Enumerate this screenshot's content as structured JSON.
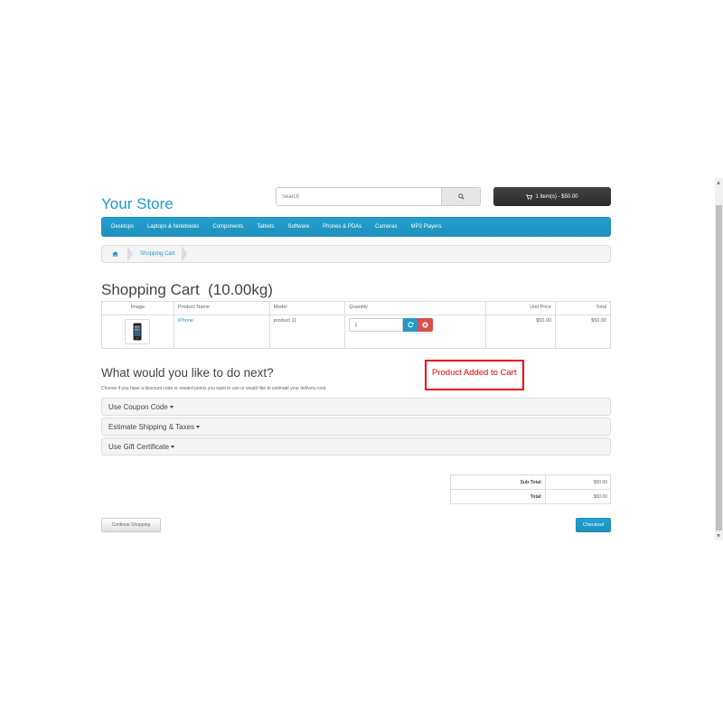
{
  "header": {
    "store_name": "Your Store",
    "search_placeholder": "Search",
    "cart_summary": "1 item(s) - $50.00"
  },
  "nav": {
    "items": [
      "Desktops",
      "Laptops & Notebooks",
      "Components",
      "Tablets",
      "Software",
      "Phones & PDAs",
      "Cameras",
      "MP3 Players"
    ]
  },
  "breadcrumb": {
    "current": "Shopping Cart"
  },
  "cart": {
    "title": "Shopping Cart  (10.00kg)",
    "columns": {
      "image": "Image",
      "name": "Product Name",
      "model": "Model",
      "quantity": "Quantity",
      "unit_price": "Unit Price",
      "total": "Total"
    },
    "rows": [
      {
        "name": "iPhone",
        "model": "product 11",
        "quantity": "1",
        "unit_price": "$50.00",
        "total": "$50.00"
      }
    ]
  },
  "notice": "Product Added to Cart",
  "next": {
    "title": "What would you like to do next?",
    "description": "Choose if you have a discount code or reward points you want to use or would like to estimate your delivery cost.",
    "panels": [
      "Use Coupon Code",
      "Estimate Shipping & Taxes",
      "Use Gift Certificate"
    ]
  },
  "totals": {
    "subtotal_label": "Sub-Total:",
    "subtotal_value": "$50.00",
    "total_label": "Total:",
    "total_value": "$50.00"
  },
  "buttons": {
    "continue": "Continue Shopping",
    "checkout": "Checkout"
  },
  "colors": {
    "accent": "#229ac8",
    "danger": "#da4f49",
    "notice": "#ee0000"
  },
  "icons": {
    "search": "search-icon",
    "cart": "shopping-cart-icon",
    "home": "home-icon",
    "refresh": "refresh-icon",
    "remove": "remove-icon"
  }
}
